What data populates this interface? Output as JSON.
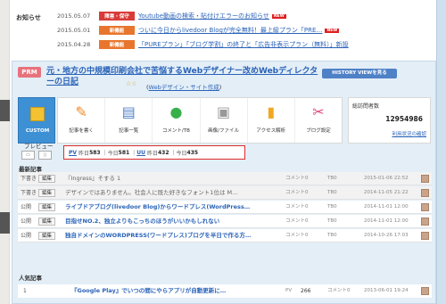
{
  "notices": {
    "title": "お知らせ",
    "items": [
      {
        "date": "2015.05.07",
        "tag": "障害・保守",
        "text": "Youtube動画の検索・貼付けエラーのお知らせ",
        "new": "NEW"
      },
      {
        "date": "2015.05.01",
        "tag": "新機能",
        "text": "ついに今日からlivedoor Blogが完全無料！最上級プラン「PRE…",
        "new": "NEW"
      },
      {
        "date": "2015.04.28",
        "tag": "新機能",
        "text": "「PUREプラン」「ブログ学割」の終了と「広告非表示プラン（無料）」新設",
        "new": ""
      }
    ]
  },
  "blog": {
    "badge": "PRM",
    "title": "元・地方の中規模印刷会社で苦悩するWebデザイナー改めWebディレクターの日記",
    "stars": "☆☆",
    "category": "Webデザイン・サイト作成",
    "history_button": "HISTORY VIEWを見る",
    "custom_label": "CUSTOM",
    "tools": [
      {
        "label": "記事を書く",
        "icon": "pencil-icon",
        "glyph": "✎",
        "color": "#f08a24"
      },
      {
        "label": "記事一覧",
        "icon": "document-icon",
        "glyph": "▤",
        "color": "#4f81c7"
      },
      {
        "label": "コメント/TB",
        "icon": "comment-icon",
        "glyph": "●",
        "color": "#38b04a"
      },
      {
        "label": "画像/ファイル",
        "icon": "image-icon",
        "glyph": "▣",
        "color": "#999999"
      },
      {
        "label": "アクセス解析",
        "icon": "chart-icon",
        "glyph": "▮",
        "color": "#f0a824"
      },
      {
        "label": "ブログ設定",
        "icon": "wrench-icon",
        "glyph": "✂",
        "color": "#e0457b"
      }
    ],
    "visitors_label": "総訪問者数",
    "visitors_count": "12954986",
    "visitors_link": "利用状況の確認",
    "preview_label": "プレビュー",
    "stats": {
      "pv_label": "PV",
      "pv_yesterday_label": "昨日",
      "pv_yesterday": "583",
      "pv_today_label": "今日",
      "pv_today": "581",
      "uu_label": "UU",
      "uu_yesterday_label": "昨日",
      "uu_yesterday": "432",
      "uu_today_label": "今日",
      "uu_today": "435"
    }
  },
  "latest": {
    "title": "最新記事",
    "rows": [
      {
        "status": "下書き",
        "edit": "編集",
        "title": "『Ingress』そする 1",
        "comments": "コメント0",
        "tb": "TB0",
        "date": "2015-01-06 22:52",
        "gray": true
      },
      {
        "status": "下書き",
        "edit": "編集",
        "title": "デザインではありません。社会人に既た好きなフォント1位は M…",
        "comments": "コメント0",
        "tb": "TB0",
        "date": "2014-11-05 21:22",
        "gray": true
      },
      {
        "status": "公開",
        "edit": "編集",
        "title": "ライブドアブログ(livedoor Blog)からワードプレス(WordPress…",
        "comments": "コメント0",
        "tb": "TB0",
        "date": "2014-11-01 12:00",
        "gray": false
      },
      {
        "status": "公開",
        "edit": "編集",
        "title": "目指せNO.2、独立よりもこっちのほうがいいかもしれない",
        "comments": "コメント0",
        "tb": "TB0",
        "date": "2014-11-01 12:00",
        "gray": false
      },
      {
        "status": "公開",
        "edit": "編集",
        "title": "独自ドメインのWORDPRESS(ワードプレス)ブログを半日で作る方…",
        "comments": "コメント0",
        "tb": "TB0",
        "date": "2014-10-26 17:03",
        "gray": false
      }
    ]
  },
  "popular": {
    "title": "人気記事",
    "rows": [
      {
        "rank": "1",
        "title": "『Google Play』でいつの間にやらアプリが自動更新に…",
        "pv_label": "PV",
        "pv": "266",
        "comments": "コメント0",
        "date": "2013-06-01 19:24"
      }
    ]
  }
}
